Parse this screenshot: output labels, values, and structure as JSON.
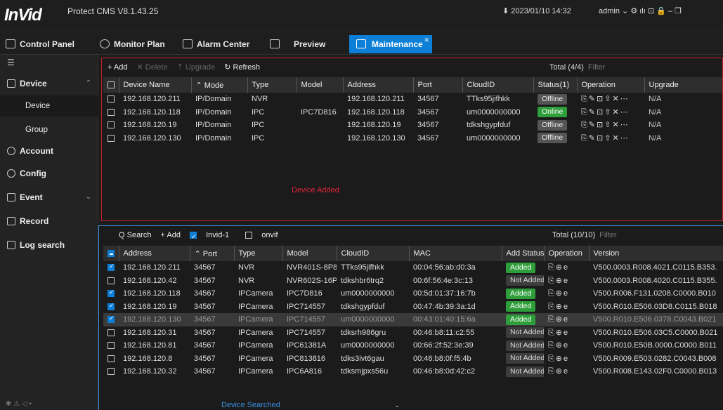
{
  "app": {
    "logo": "InVid",
    "logo_sub": "Innovative Video Technology",
    "title": "Protect CMS V8.1.43.25",
    "datetime": "2023/01/10 14:32",
    "user": "admin"
  },
  "tabs": [
    {
      "label": "Control Panel"
    },
    {
      "label": "Monitor Plan"
    },
    {
      "label": "Alarm Center"
    },
    {
      "label": "Preview"
    },
    {
      "label": "Maintenance"
    }
  ],
  "sidebar": {
    "items": [
      {
        "label": "Device"
      },
      {
        "label": "Device"
      },
      {
        "label": "Group"
      },
      {
        "label": "Account"
      },
      {
        "label": "Config"
      },
      {
        "label": "Event"
      },
      {
        "label": "Record"
      },
      {
        "label": "Log search"
      }
    ]
  },
  "top": {
    "toolbar": {
      "add": "+ Add",
      "delete": "✕ Delete",
      "upgrade": "⇡ Upgrade",
      "refresh": "↻ Refresh"
    },
    "total": "Total (4/4)",
    "filter": "Filter",
    "headers": [
      "Device Name",
      "Mode",
      "Type",
      "Model",
      "Address",
      "Port",
      "CloudID",
      "Status(1)",
      "Operation",
      "Upgrade"
    ],
    "rows": [
      {
        "name": "192.168.120.211",
        "mode": "IP/Domain",
        "type": "NVR",
        "model": "",
        "address": "192.168.120.211",
        "port": "34567",
        "cloud": "TTks95jifhkk",
        "status": "Offline",
        "ops": "⎘✎⊡⇧✕⋯",
        "upgrade": "N/A"
      },
      {
        "name": "192.168.120.118",
        "mode": "IP/Domain",
        "type": "IPC",
        "model": "IPC7D816",
        "address": "192.168.120.118",
        "port": "34567",
        "cloud": "um0000000000",
        "status": "Online",
        "ops": "⎘✎⊡⇧✕⋯",
        "upgrade": "N/A"
      },
      {
        "name": "192.168.120.19",
        "mode": "IP/Domain",
        "type": "IPC",
        "model": "",
        "address": "192.168.120.19",
        "port": "34567",
        "cloud": "tdkshgypfduf",
        "status": "Offline",
        "ops": "⎘✎⊡⇧✕⋯",
        "upgrade": "N/A"
      },
      {
        "name": "192.168.120.130",
        "mode": "IP/Domain",
        "type": "IPC",
        "model": "",
        "address": "192.168.120.130",
        "port": "34567",
        "cloud": "um0000000000",
        "status": "Offline",
        "ops": "⎘✎⊡⇧✕⋯",
        "upgrade": "N/A"
      }
    ],
    "message": "Device Added"
  },
  "bottom": {
    "toolbar": {
      "search": "Q Search",
      "add": "+ Add",
      "invid": "Invid-1",
      "onvif": "onvif"
    },
    "total": "Total (10/10)",
    "filter": "Filter",
    "headers": [
      "Address",
      "Port",
      "Type",
      "Model",
      "CloudID",
      "MAC",
      "Add Status",
      "Operation",
      "Version"
    ],
    "rows": [
      {
        "checked": true,
        "address": "192.168.120.211",
        "port": "34567",
        "type": "NVR",
        "model": "NVR401S-8P8",
        "cloud": "TTks95jifhkk",
        "mac": "00:04:56:ab:d0:3a",
        "status": "Added",
        "ops": "⎘⊕e",
        "version": "V500.0003.R008.4021.C0115.B353."
      },
      {
        "checked": false,
        "address": "192.168.120.42",
        "port": "34567",
        "type": "NVR",
        "model": "NVR602S-16P16",
        "cloud": "tdkshbr6trq2",
        "mac": "00:6f:56:4e:3c:13",
        "status": "Not Added",
        "ops": "⎘⊕e",
        "version": "V500.0003.R008.4020.C0115.B355."
      },
      {
        "checked": true,
        "address": "192.168.120.118",
        "port": "34567",
        "type": "IPCamera",
        "model": "IPC7D816",
        "cloud": "um0000000000",
        "mac": "00:5d:01:37:16:7b",
        "status": "Added",
        "ops": "⎘⊕e",
        "version": "V500.R006.F131.0208.C0000.B010"
      },
      {
        "checked": true,
        "address": "192.168.120.19",
        "port": "34567",
        "type": "IPCamera",
        "model": "IPC714557",
        "cloud": "tdkshgypfduf",
        "mac": "00:47:4b:39:3a:1d",
        "status": "Added",
        "ops": "⎘⊕e",
        "version": "V500.R010.E506.03D8.C0115.B018"
      },
      {
        "checked": true,
        "address": "192.168.120.130",
        "port": "34567",
        "type": "IPCamera",
        "model": "IPC714557",
        "cloud": "um0000000000",
        "mac": "00:43:01:40:15:6a",
        "status": "Added",
        "ops": "⎘⊕e",
        "version": "V500.R010.E506.0378.C0043.B021"
      },
      {
        "checked": false,
        "address": "192.168.120.31",
        "port": "34567",
        "type": "IPCamera",
        "model": "IPC714557",
        "cloud": "tdksrh986gru",
        "mac": "00:46:b8:11:c2:55",
        "status": "Not Added",
        "ops": "⎘⊕e",
        "version": "V500.R010.E506.03C5.C0000.B021"
      },
      {
        "checked": false,
        "address": "192.168.120.81",
        "port": "34567",
        "type": "IPCamera",
        "model": "IPC61381A",
        "cloud": "um0000000000",
        "mac": "00:66:2f:52:3e:39",
        "status": "Not Added",
        "ops": "⎘⊕e",
        "version": "V500.R010.E50B.0000.C0000.B011"
      },
      {
        "checked": false,
        "address": "192.168.120.8",
        "port": "34567",
        "type": "IPCamera",
        "model": "IPC813816",
        "cloud": "tdks3ivt6gau",
        "mac": "00:46:b8:0f:f5:4b",
        "status": "Not Added",
        "ops": "⎘⊕e",
        "version": "V500.R009.E503.0282.C0043.B008"
      },
      {
        "checked": false,
        "address": "192.168.120.32",
        "port": "34567",
        "type": "IPCamera",
        "model": "IPC6A816",
        "cloud": "tdksmjpxs56u",
        "mac": "00:46:b8:0d:42:c2",
        "status": "Not Added",
        "ops": "⎘⊕e",
        "version": "V500.R008.E143.02F0.C0000.B013"
      }
    ],
    "message": "Device Searched"
  },
  "colors": {
    "accent": "#0e7fd6",
    "online": "#2e9e3a",
    "alert": "#e0243a"
  }
}
